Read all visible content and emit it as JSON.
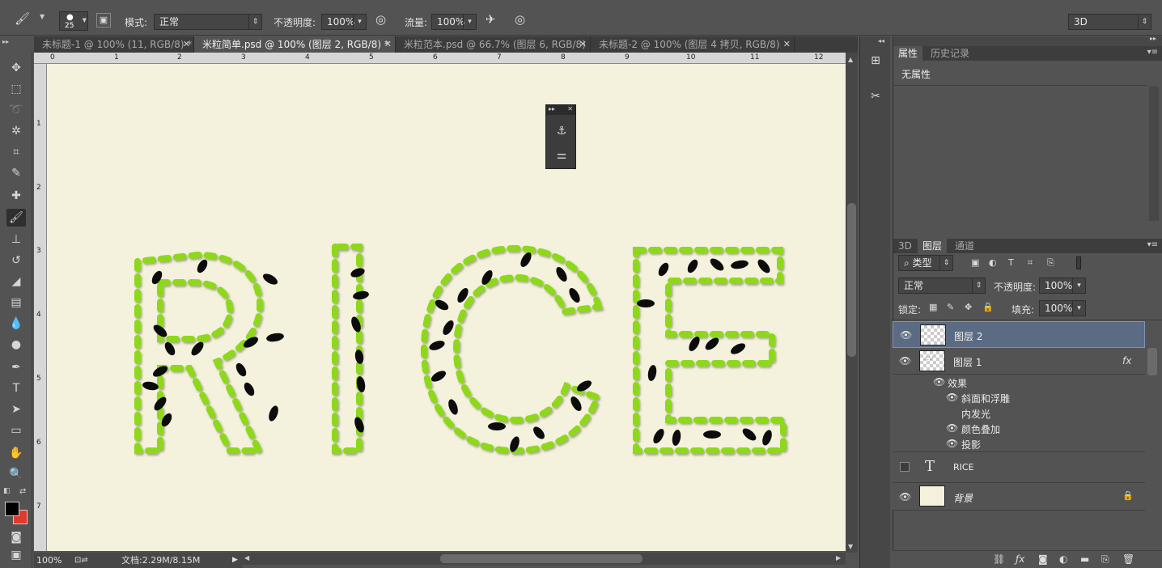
{
  "options_bar": {
    "brush_size": "25",
    "mode_label": "模式:",
    "mode_value": "正常",
    "opacity_label": "不透明度:",
    "opacity_value": "100%",
    "flow_label": "流量:",
    "flow_value": "100%",
    "workspace": "3D"
  },
  "doc_tabs": [
    {
      "label": "未标题-1 @ 100% (11, RGB/8) *",
      "active": false
    },
    {
      "label": "米粒简单.psd @ 100% (图层 2, RGB/8) *",
      "active": true
    },
    {
      "label": "米粒范本.psd @ 66.7% (图层 6, RGB/8)",
      "active": false
    },
    {
      "label": "未标题-2 @ 100% (图层 4 拷贝, RGB/8)",
      "active": false
    }
  ],
  "ruler_h": [
    "0",
    "1",
    "2",
    "3",
    "4",
    "5",
    "6",
    "7",
    "8",
    "9",
    "10",
    "11",
    "12"
  ],
  "ruler_v": [
    "1",
    "2",
    "3",
    "4",
    "5",
    "6",
    "7"
  ],
  "canvas_text": "RICE",
  "status": {
    "zoom": "100%",
    "doc_size": "文档:2.29M/8.15M"
  },
  "properties_panel": {
    "tabs": [
      "属性",
      "历史记录"
    ],
    "content": "无属性"
  },
  "layers_panel": {
    "tabs": [
      "3D",
      "图层",
      "通道"
    ],
    "filter_label": "类型",
    "blend_mode": "正常",
    "opacity_label": "不透明度:",
    "opacity_value": "100%",
    "lock_label": "锁定:",
    "fill_label": "填充:",
    "fill_value": "100%",
    "layers": [
      {
        "name": "图层 2",
        "selected": true
      },
      {
        "name": "图层 1",
        "fx": "fx"
      },
      {
        "name": "RICE",
        "type": "text-icon"
      },
      {
        "name": "背景",
        "locked": true
      }
    ],
    "effects_label": "效果",
    "effects": [
      "斜面和浮雕",
      "内发光",
      "颜色叠加",
      "投影"
    ]
  },
  "colors": {
    "fg": "#000000",
    "bg": "#e23a2a",
    "canvas": "#f4f1dc",
    "rice_green": "#8ed81a",
    "selected_layer": "#5b6b84"
  }
}
